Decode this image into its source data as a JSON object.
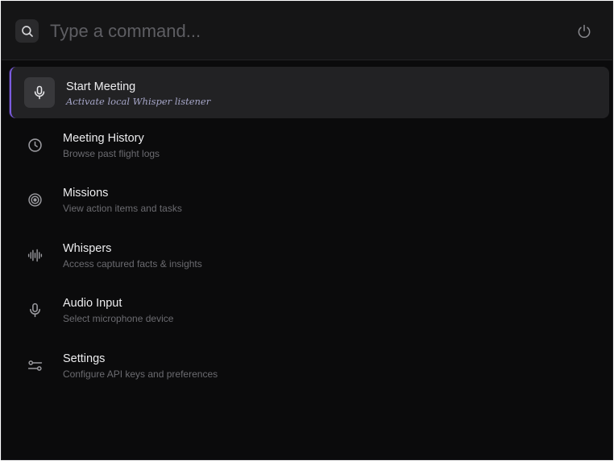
{
  "command_bar": {
    "placeholder": "Type a command...",
    "value": "",
    "search_icon": "search-icon",
    "power_icon": "power-icon"
  },
  "menu": {
    "items": [
      {
        "label": "Start Meeting",
        "description": "Activate local Whisper listener",
        "icon": "microphone-icon",
        "active": true
      },
      {
        "label": "Meeting History",
        "description": "Browse past flight logs",
        "icon": "clock-icon",
        "active": false
      },
      {
        "label": "Missions",
        "description": "View action items and tasks",
        "icon": "target-icon",
        "active": false
      },
      {
        "label": "Whispers",
        "description": "Access captured facts & insights",
        "icon": "waveform-icon",
        "active": false
      },
      {
        "label": "Audio Input",
        "description": "Select microphone device",
        "icon": "microphone-icon",
        "active": false
      },
      {
        "label": "Settings",
        "description": "Configure API keys and preferences",
        "icon": "sliders-icon",
        "active": false
      }
    ]
  },
  "colors": {
    "background": "#0b0b0c",
    "bar_background": "#151516",
    "active_item_background": "#222224",
    "accent": "#7c5ce0",
    "title_text": "#ececee",
    "description_text": "#6b6b70"
  }
}
